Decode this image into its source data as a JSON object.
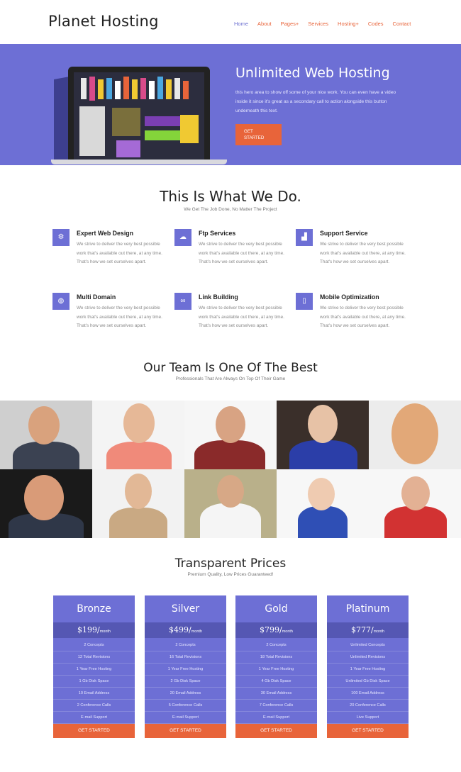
{
  "header": {
    "logo": "Planet Hosting",
    "nav": [
      "Home",
      "About",
      "Pages+",
      "Services",
      "Hosting+",
      "Codes",
      "Contact"
    ]
  },
  "hero": {
    "title": "Unlimited Web Hosting",
    "text": "this hero area to show off some of your nice work. You can even have a video inside it since it's great as a secondary call to action alongside this button underneath this text.",
    "button": "GET STARTED"
  },
  "services": {
    "title": "This Is What We Do.",
    "subtitle": "We Get The Job Done, No Matter The Project",
    "items": [
      {
        "icon": "gear-icon",
        "title": "Expert Web Design",
        "text": "We strive to deliver the very best possible work that's available out there, at any time. That's how we set ourselves apart."
      },
      {
        "icon": "cloud-icon",
        "title": "Ftp Services",
        "text": "We strive to deliver the very best possible work that's available out there, at any time. That's how we set ourselves apart."
      },
      {
        "icon": "signal-icon",
        "title": "Support Service",
        "text": "We strive to deliver the very best possible work that's available out there, at any time. That's how we set ourselves apart."
      },
      {
        "icon": "globe-icon",
        "title": "Multi Domain",
        "text": "We strive to deliver the very best possible work that's available out there, at any time. That's how we set ourselves apart."
      },
      {
        "icon": "link-icon",
        "title": "Link Building",
        "text": "We strive to deliver the very best possible work that's available out there, at any time. That's how we set ourselves apart."
      },
      {
        "icon": "mobile-icon",
        "title": "Mobile Optimization",
        "text": "We strive to deliver the very best possible work that's available out there, at any time. That's how we set ourselves apart."
      }
    ]
  },
  "team": {
    "title": "Our Team Is One Of The Best",
    "subtitle": "Professionals That Are Always On Top Of Their Game"
  },
  "pricing": {
    "title": "Transparent Prices",
    "subtitle": "Premium Quality, Low Prices Guaranteed!",
    "plans": [
      {
        "name": "Bronze",
        "price": "$199/",
        "period": "month",
        "features": [
          "2 Concepts",
          "12 Total Revisions",
          "1 Year Free Hosting",
          "1 Gb Disk Space",
          "10 Email Address",
          "2 Conference Calls",
          "E-mail Support"
        ],
        "button": "GET STARTED"
      },
      {
        "name": "Silver",
        "price": "$499/",
        "period": "month",
        "features": [
          "2 Concepts",
          "16 Total Revisions",
          "1 Year Free Hosting",
          "2 Gb Disk Space",
          "20 Email Address",
          "5 Conference Calls",
          "E-mail Support"
        ],
        "button": "GET STARTED"
      },
      {
        "name": "Gold",
        "price": "$799/",
        "period": "month",
        "features": [
          "2 Concepts",
          "18 Total Revisions",
          "1 Year Free Hosting",
          "4 Gb Disk Space",
          "30 Email Address",
          "7 Conference Calls",
          "E-mail Support"
        ],
        "button": "GET STARTED"
      },
      {
        "name": "Platinum",
        "price": "$777/",
        "period": "month",
        "features": [
          "Unlimited Concepts",
          "Unlimited Revisions",
          "1 Year Free Hosting",
          "Unlimited Gb Disk Space",
          "100 Email Address",
          "20 Conference Calls",
          "Live Support"
        ],
        "button": "GET STARTED"
      }
    ]
  },
  "colors": {
    "accent": "#6d6fd5",
    "button": "#e8643a",
    "price_band": "#5557b3"
  }
}
